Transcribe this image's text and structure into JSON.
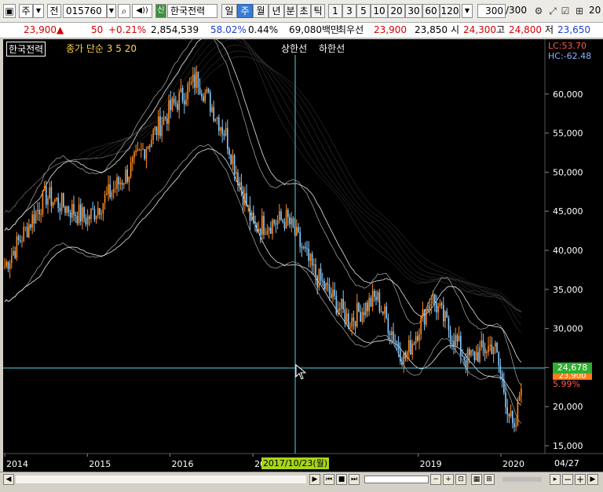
{
  "toolbar": {
    "type_label": "주",
    "scope_label": "전",
    "code_value": "015760",
    "stock_name": "한국전력",
    "badge": "신",
    "periods": [
      "일",
      "주",
      "월",
      "년",
      "분",
      "초",
      "틱"
    ],
    "active_period": "주",
    "intervals": [
      "1",
      "3",
      "5",
      "10",
      "20",
      "30",
      "60",
      "120"
    ],
    "count_value": "300",
    "count_total": "/300",
    "right_edge": "20"
  },
  "quote": {
    "price": "23,900",
    "change_arrow": "▲",
    "change": "50",
    "change_rate": "+0.21%",
    "volume": "2,854,539",
    "volume_ratio": "58.02%",
    "turnover": "0.44%",
    "amount": "69,080백만",
    "prev_label": "최우선",
    "best_ask": "23,900",
    "best_bid": "23,850",
    "open_label": "시",
    "open": "24,300",
    "high_label": "고",
    "high": "24,800",
    "low_label": "저",
    "low": "23,650"
  },
  "chart": {
    "legend_name": "한국전력",
    "legend_ma": "종가 단순 3 5 20",
    "legend_env": "상한선",
    "legend_env_low": "하한선",
    "lc_label": "LC:53.70",
    "hc_label": "HC:-62.48",
    "y_ticks": [
      "60,000",
      "55,000",
      "50,000",
      "45,000",
      "40,000",
      "35,000",
      "30,000",
      "25,000",
      "20,000",
      "15,000"
    ],
    "x_ticks": [
      "2014",
      "2015",
      "2016",
      "2017",
      "2019",
      "2020"
    ],
    "crosshair_date": "2017/10/23(월)",
    "last_label": "04/27",
    "crosshair_price": "24,678",
    "current_price": "23,900",
    "pct_label": "5.99%",
    "colors": {
      "up": "#ff8a1e",
      "down": "#88ccff",
      "band": "#ffffff",
      "cross": "#5ad4e6",
      "tag": "#22aa22"
    }
  },
  "chart_data": {
    "type": "candlestick",
    "x_range": [
      "2014-01",
      "2020-04"
    ],
    "y_range": [
      14000,
      65000
    ],
    "close_weekly_approx": [
      {
        "date": "2014-01",
        "value": 38000
      },
      {
        "date": "2014-07",
        "value": 47000
      },
      {
        "date": "2015-01",
        "value": 44000
      },
      {
        "date": "2015-07",
        "value": 50000
      },
      {
        "date": "2016-01",
        "value": 58000
      },
      {
        "date": "2016-05",
        "value": 62000
      },
      {
        "date": "2016-09",
        "value": 55000
      },
      {
        "date": "2017-01",
        "value": 43000
      },
      {
        "date": "2017-06",
        "value": 44000
      },
      {
        "date": "2017-10",
        "value": 37000
      },
      {
        "date": "2018-03",
        "value": 31000
      },
      {
        "date": "2018-07",
        "value": 34000
      },
      {
        "date": "2018-11",
        "value": 26000
      },
      {
        "date": "2019-03",
        "value": 34000
      },
      {
        "date": "2019-08",
        "value": 26000
      },
      {
        "date": "2019-12",
        "value": 28000
      },
      {
        "date": "2020-03",
        "value": 16000
      },
      {
        "date": "2020-04",
        "value": 23900
      }
    ]
  }
}
